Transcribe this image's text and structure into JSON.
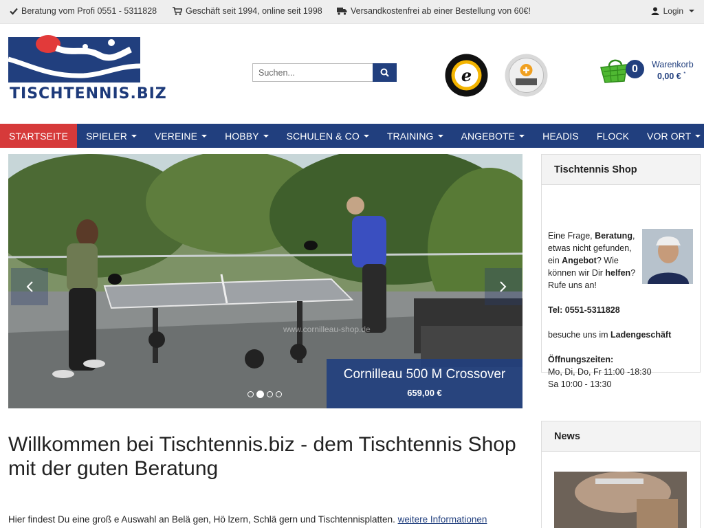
{
  "topbar": {
    "advice": "Beratung vom Profi 0551 - 5311828",
    "since": "Geschäft seit 1994, online seit 1998",
    "shipping": "Versandkostenfrei ab einer Bestellung von 60€!",
    "login": "Login"
  },
  "header": {
    "logo_text": "TISCHTENNIS.BIZ",
    "search_placeholder": "Suchen...",
    "cart": {
      "count": "0",
      "label": "Warenkorb",
      "total": "0,00 €",
      "total_mark": "*"
    }
  },
  "nav": {
    "items": [
      {
        "label": "STARTSEITE",
        "dropdown": false,
        "active": true
      },
      {
        "label": "SPIELER",
        "dropdown": true
      },
      {
        "label": "VEREINE",
        "dropdown": true
      },
      {
        "label": "HOBBY",
        "dropdown": true
      },
      {
        "label": "SCHULEN & CO",
        "dropdown": true
      },
      {
        "label": "TRAINING",
        "dropdown": true
      },
      {
        "label": "ANGEBOTE",
        "dropdown": true
      },
      {
        "label": "HEADIS",
        "dropdown": false
      },
      {
        "label": "FLOCK",
        "dropdown": false
      },
      {
        "label": "VOR ORT",
        "dropdown": true
      }
    ]
  },
  "slider": {
    "caption_title": "Cornilleau 500 M Crossover",
    "caption_price": "659,00 €",
    "watermark": "www.cornilleau-shop.de",
    "active_dot": 1
  },
  "main": {
    "welcome": "Willkommen bei Tischtennis.biz - dem Tischtennis Shop mit der guten Beratung",
    "intro": "Hier findest Du eine groß e Auswahl an Belä gen, Hö lzern, Schlä gern und Tischtennisplatten.",
    "intro_link": "weitere Informationen"
  },
  "shop_box": {
    "title": "Tischtennis Shop",
    "q1": "Eine Frage, ",
    "q1b": "Beratung",
    "q2": ", etwas nicht gefunden, ein ",
    "q2b": "Angebot",
    "q3": "? Wie können wir Dir ",
    "q3b": "helfen",
    "q4": "? Rufe uns an!",
    "tel": "Tel: 0551-5311828",
    "visit": "besuche uns im ",
    "visit_b": "Ladengeschäft",
    "hours_title": "Öffnungszeiten:",
    "hours1": "Mo, Di, Do, Fr 11:00 -18:30",
    "hours2": "Sa 10:00 - 13:30"
  },
  "news_box": {
    "title": "News"
  },
  "colors": {
    "brand_blue": "#213f7e",
    "active_red": "#d63a3a",
    "logo_red": "#e23a3a"
  }
}
